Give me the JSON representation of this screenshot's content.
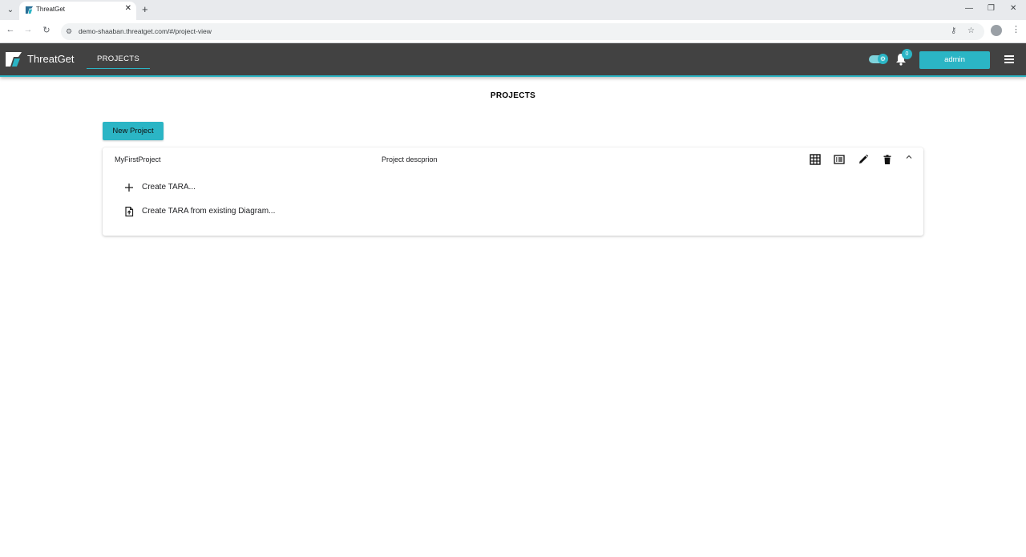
{
  "browser": {
    "tab_title": "ThreatGet",
    "url": "demo-shaaban.threatget.com/#/project-view"
  },
  "app": {
    "brand": "ThreatGet",
    "nav": {
      "projects": "PROJECTS"
    },
    "notifications_count": "0",
    "user_button": "admin",
    "accent_color": "#2bb5c5",
    "header_color": "#424242"
  },
  "page": {
    "title": "PROJECTS",
    "new_project_label": "New Project",
    "projects": [
      {
        "name": "MyFirstProject",
        "description": "Project descprion",
        "actions": [
          {
            "label": "Create TARA...",
            "icon": "plus-icon"
          },
          {
            "label": "Create TARA from existing Diagram...",
            "icon": "file-upload-icon"
          }
        ]
      }
    ]
  }
}
